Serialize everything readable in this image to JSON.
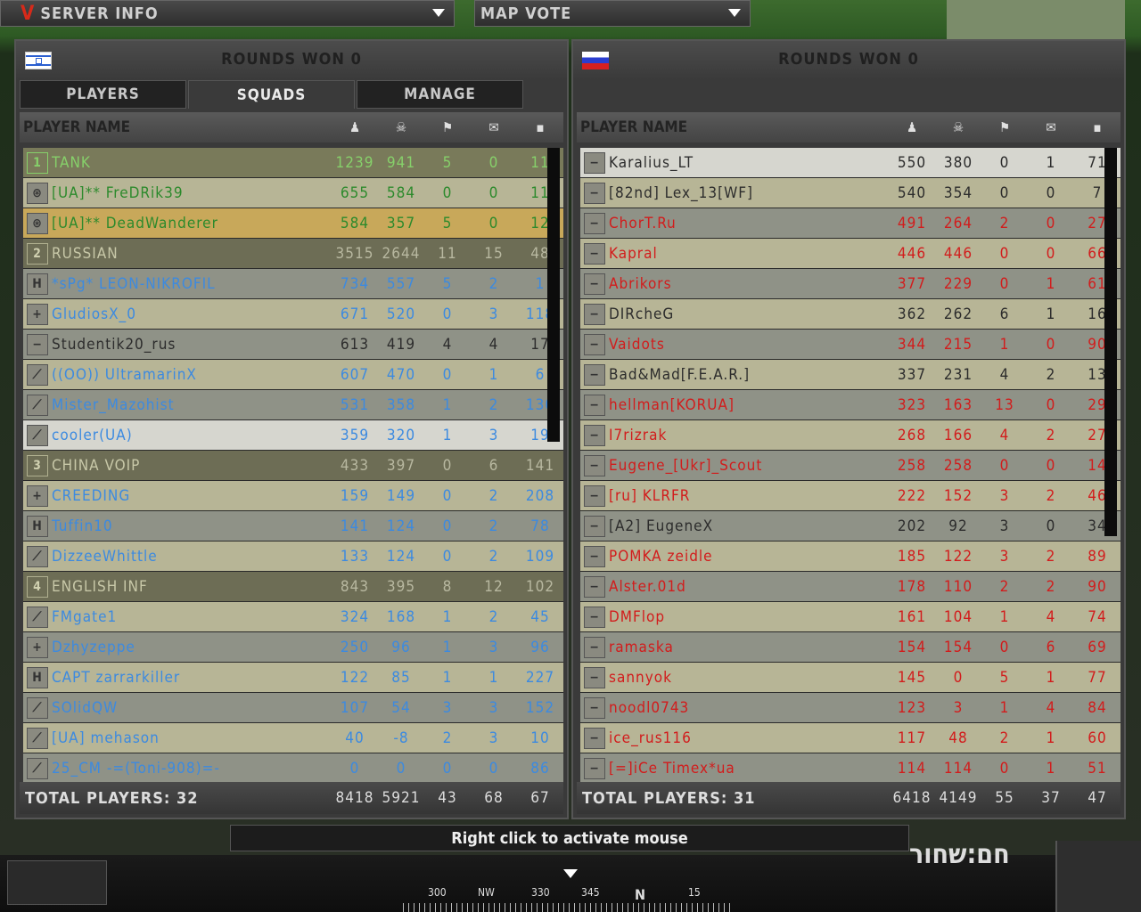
{
  "top": {
    "server_info": "SERVER INFO",
    "map_vote": "MAP VOTE"
  },
  "left": {
    "rounds": "ROUNDS WON 0",
    "tabs": [
      "PLAYERS",
      "SQUADS",
      "MANAGE"
    ],
    "col_player": "PLAYER NAME",
    "total_label": "TOTAL PLAYERS: 32",
    "totals": [
      "8418",
      "5921",
      "43",
      "68",
      "67"
    ],
    "rows": [
      {
        "type": "sq",
        "icon": "1",
        "name": "TANK",
        "v": [
          "1239",
          "941",
          "5",
          "0",
          "11"
        ],
        "cls": "greensq"
      },
      {
        "type": "pl",
        "icon": "⊛",
        "name": "[UA]** FreDRik39",
        "v": [
          "655",
          "584",
          "0",
          "0",
          "11"
        ],
        "cls": "rA green"
      },
      {
        "type": "pl",
        "icon": "⊛",
        "name": "[UA]** DeadWanderer",
        "v": [
          "584",
          "357",
          "5",
          "0",
          "12"
        ],
        "cls": "rHi green"
      },
      {
        "type": "sq",
        "icon": "2",
        "name": "RUSSIAN",
        "v": [
          "3515",
          "2644",
          "11",
          "15",
          "48"
        ],
        "cls": "sq"
      },
      {
        "type": "pl",
        "icon": "H",
        "name": "*sPg* LEON-NIKROFIL",
        "v": [
          "734",
          "557",
          "5",
          "2",
          "1"
        ],
        "cls": "rB blue"
      },
      {
        "type": "pl",
        "icon": "+",
        "name": "  GludiosX_0",
        "v": [
          "671",
          "520",
          "0",
          "3",
          "118"
        ],
        "cls": "rA blue"
      },
      {
        "type": "pl",
        "icon": "−",
        "name": "  Studentik20_rus",
        "v": [
          "613",
          "419",
          "4",
          "4",
          "17"
        ],
        "cls": "rB gray"
      },
      {
        "type": "pl",
        "icon": "⟋",
        "name": "((OO)) UltramarinX",
        "v": [
          "607",
          "470",
          "0",
          "1",
          "6"
        ],
        "cls": "rA blue"
      },
      {
        "type": "pl",
        "icon": "⟋",
        "name": "  Mister_Mazohist",
        "v": [
          "531",
          "358",
          "1",
          "2",
          "130"
        ],
        "cls": "rB blue"
      },
      {
        "type": "pl",
        "icon": "⟋",
        "name": "  cooler(UA)",
        "v": [
          "359",
          "320",
          "1",
          "3",
          "19"
        ],
        "cls": "rSel blue"
      },
      {
        "type": "sq",
        "icon": "3",
        "name": "CHINA VOIP",
        "v": [
          "433",
          "397",
          "0",
          "6",
          "141"
        ],
        "cls": "sq"
      },
      {
        "type": "pl",
        "icon": "+",
        "name": "  CREEDING",
        "v": [
          "159",
          "149",
          "0",
          "2",
          "208"
        ],
        "cls": "rA blue"
      },
      {
        "type": "pl",
        "icon": "H",
        "name": "  Tuffin10",
        "v": [
          "141",
          "124",
          "0",
          "2",
          "78"
        ],
        "cls": "rB blue"
      },
      {
        "type": "pl",
        "icon": "⟋",
        "name": "  DizzeeWhittle",
        "v": [
          "133",
          "124",
          "0",
          "2",
          "109"
        ],
        "cls": "rA blue"
      },
      {
        "type": "sq",
        "icon": "4",
        "name": "ENGLISH INF",
        "v": [
          "843",
          "395",
          "8",
          "12",
          "102"
        ],
        "cls": "sq"
      },
      {
        "type": "pl",
        "icon": "⟋",
        "name": "  FMgate1",
        "v": [
          "324",
          "168",
          "1",
          "2",
          "45"
        ],
        "cls": "rA blue"
      },
      {
        "type": "pl",
        "icon": "+",
        "name": "  Dzhyzeppe",
        "v": [
          "250",
          "96",
          "1",
          "3",
          "96"
        ],
        "cls": "rB blue"
      },
      {
        "type": "pl",
        "icon": "H",
        "name": "CAPT zarrarkiller",
        "v": [
          "122",
          "85",
          "1",
          "1",
          "227"
        ],
        "cls": "rA blue"
      },
      {
        "type": "pl",
        "icon": "⟋",
        "name": "  SOlidQW",
        "v": [
          "107",
          "54",
          "3",
          "3",
          "152"
        ],
        "cls": "rB blue"
      },
      {
        "type": "pl",
        "icon": "⟋",
        "name": "[UA] mehason",
        "v": [
          "40",
          "-8",
          "2",
          "3",
          "10"
        ],
        "cls": "rA blue"
      },
      {
        "type": "pl",
        "icon": "⟋",
        "name": "25_CM -=(Toni-908)=-",
        "v": [
          "0",
          "0",
          "0",
          "0",
          "86"
        ],
        "cls": "rB blue"
      }
    ]
  },
  "right": {
    "rounds": "ROUNDS WON 0",
    "col_player": "PLAYER NAME",
    "total_label": "TOTAL PLAYERS: 31",
    "totals": [
      "6418",
      "4149",
      "55",
      "37",
      "47"
    ],
    "rows": [
      {
        "name": "  Karalius_LT",
        "v": [
          "550",
          "380",
          "0",
          "1",
          "71"
        ],
        "cls": "rSel gray"
      },
      {
        "name": "[82nd] Lex_13[WF]",
        "v": [
          "540",
          "354",
          "0",
          "0",
          "7"
        ],
        "cls": "rA gray"
      },
      {
        "name": "  ChorT.Ru",
        "v": [
          "491",
          "264",
          "2",
          "0",
          "27"
        ],
        "cls": "rB red"
      },
      {
        "name": "  Kapral",
        "v": [
          "446",
          "446",
          "0",
          "0",
          "66"
        ],
        "cls": "rA red"
      },
      {
        "name": "  Abrikors",
        "v": [
          "377",
          "229",
          "0",
          "1",
          "61"
        ],
        "cls": "rB red"
      },
      {
        "name": "  DIRcheG",
        "v": [
          "362",
          "262",
          "6",
          "1",
          "16"
        ],
        "cls": "rA gray"
      },
      {
        "name": "  Vaidots",
        "v": [
          "344",
          "215",
          "1",
          "0",
          "90"
        ],
        "cls": "rB red"
      },
      {
        "name": "  Bad&Mad[F.E.A.R.]",
        "v": [
          "337",
          "231",
          "4",
          "2",
          "13"
        ],
        "cls": "rA gray"
      },
      {
        "name": "  hellman[KORUA]",
        "v": [
          "323",
          "163",
          "13",
          "0",
          "29"
        ],
        "cls": "rB red"
      },
      {
        "name": "  I7rizrak",
        "v": [
          "268",
          "166",
          "4",
          "2",
          "27"
        ],
        "cls": "rA red"
      },
      {
        "name": "  Eugene_[Ukr]_Scout",
        "v": [
          "258",
          "258",
          "0",
          "0",
          "14"
        ],
        "cls": "rB red"
      },
      {
        "name": "[ru] KLRFR",
        "v": [
          "222",
          "152",
          "3",
          "2",
          "46"
        ],
        "cls": "rA red"
      },
      {
        "name": "[A2] EugeneX",
        "v": [
          "202",
          "92",
          "3",
          "0",
          "34"
        ],
        "cls": "rB gray"
      },
      {
        "name": "POMKA zeidle",
        "v": [
          "185",
          "122",
          "3",
          "2",
          "89"
        ],
        "cls": "rA red"
      },
      {
        "name": "  Alster.01d",
        "v": [
          "178",
          "110",
          "2",
          "2",
          "90"
        ],
        "cls": "rB red"
      },
      {
        "name": "  DMFlop",
        "v": [
          "161",
          "104",
          "1",
          "4",
          "74"
        ],
        "cls": "rA red"
      },
      {
        "name": "  ramaska",
        "v": [
          "154",
          "154",
          "0",
          "6",
          "69"
        ],
        "cls": "rB red"
      },
      {
        "name": "  sannyok",
        "v": [
          "145",
          "0",
          "5",
          "1",
          "77"
        ],
        "cls": "rA red"
      },
      {
        "name": "  noodl0743",
        "v": [
          "123",
          "3",
          "1",
          "4",
          "84"
        ],
        "cls": "rB red"
      },
      {
        "name": "  ice_rus116",
        "v": [
          "117",
          "48",
          "2",
          "1",
          "60"
        ],
        "cls": "rA red"
      },
      {
        "name": "[=]iCe Timex*ua",
        "v": [
          "114",
          "114",
          "0",
          "1",
          "51"
        ],
        "cls": "rB red"
      }
    ]
  },
  "hint": "Right click to activate mouse",
  "map_name": "חם:שחור",
  "compass": {
    "labels": [
      "300",
      "NW",
      "330",
      "345",
      "N",
      "15"
    ]
  }
}
